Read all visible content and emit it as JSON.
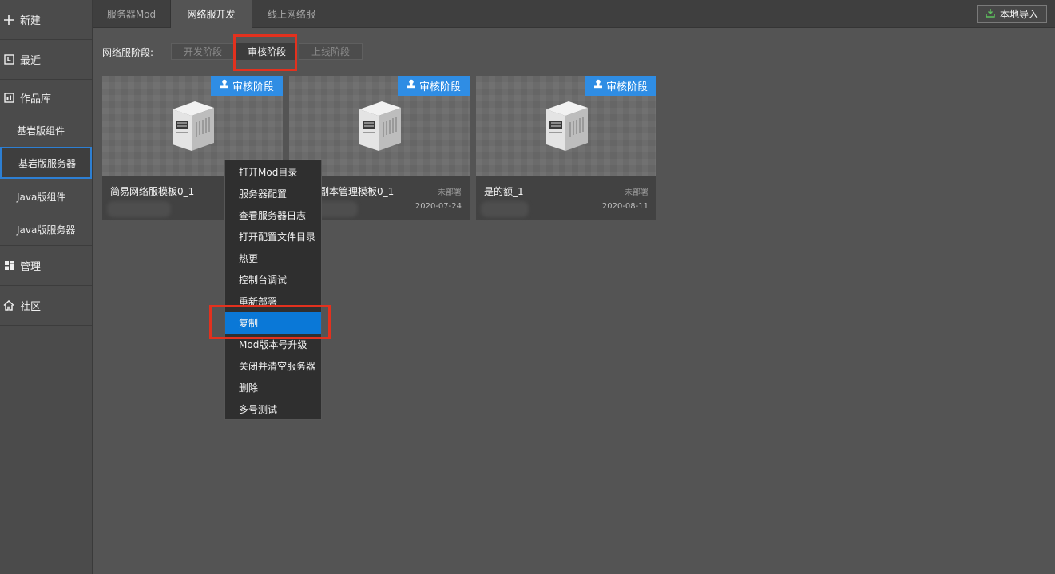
{
  "sidebar": {
    "new_label": "新建",
    "recent_label": "最近",
    "library_label": "作品库",
    "sub_items": [
      "基岩版组件",
      "基岩版服务器",
      "Java版组件",
      "Java版服务器"
    ],
    "manage_label": "管理",
    "community_label": "社区"
  },
  "tabs": [
    "服务器Mod",
    "网络服开发",
    "线上网络服"
  ],
  "active_tab": "网络服开发",
  "import_button": "本地导入",
  "stage": {
    "label": "网络服阶段:",
    "options": [
      "开发阶段",
      "审核阶段",
      "上线阶段"
    ],
    "selected": "审核阶段"
  },
  "cards": [
    {
      "badge": "审核阶段",
      "title": "简易网络服模板0_1",
      "status": "",
      "date": ""
    },
    {
      "badge": "审核阶段",
      "title": "线副本管理模板0_1",
      "status": "未部署",
      "date": "2020-07-24"
    },
    {
      "badge": "审核阶段",
      "title": "是的额_1",
      "status": "未部署",
      "date": "2020-08-11"
    }
  ],
  "context_menu": {
    "items": [
      "打开Mod目录",
      "服务器配置",
      "查看服务器日志",
      "打开配置文件目录",
      "热更",
      "控制台调试",
      "重新部署",
      "复制",
      "Mod版本号升级",
      "关闭并清空服务器",
      "删除",
      "多号测试"
    ],
    "highlighted": "复制"
  },
  "colors": {
    "accent": "#2f8de4",
    "highlight": "#0a78d7",
    "annotation_red": "#e3311e",
    "selection_border": "#2d7fd3"
  }
}
